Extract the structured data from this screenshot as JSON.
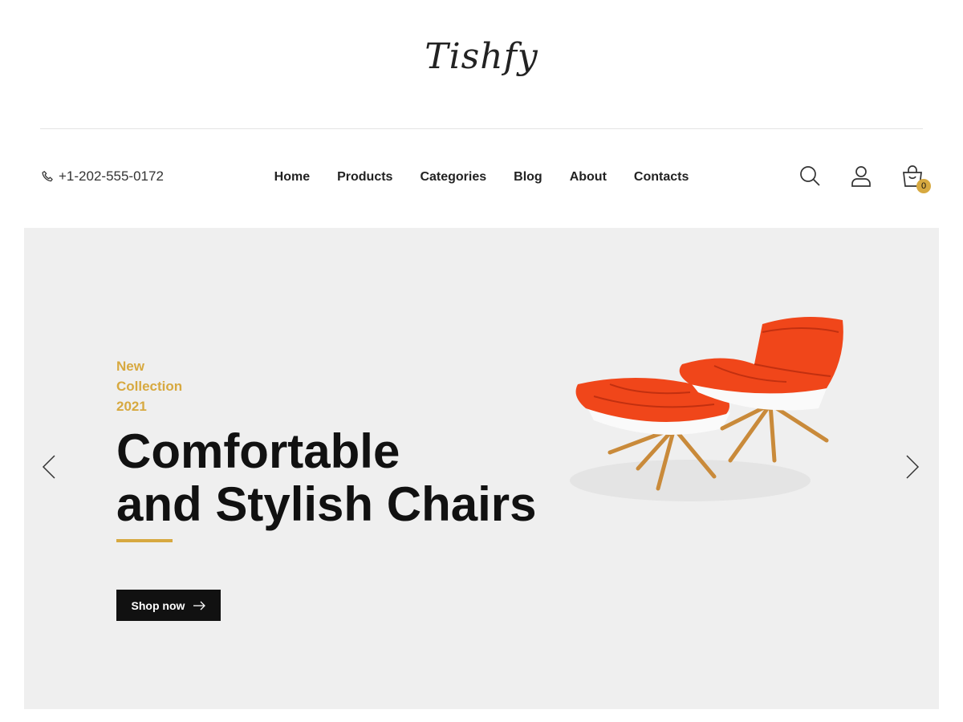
{
  "brand": {
    "logo_text": "Tishfy"
  },
  "header": {
    "phone": "+1-202-555-0172",
    "nav": [
      "Home",
      "Products",
      "Categories",
      "Blog",
      "About",
      "Contacts"
    ],
    "cart_count": "0"
  },
  "hero": {
    "eyebrow_line1": "New",
    "eyebrow_line2": "Collection",
    "eyebrow_line3": "2021",
    "headline_line1": "Comfortable",
    "headline_line2": "and Stylish Chairs",
    "button_label": "Shop now"
  },
  "colors": {
    "accent": "#d7a940",
    "hero_bg": "#efefef",
    "text": "#111111",
    "chair": "#f0461a",
    "chair_legs": "#c98a3a"
  },
  "icons": [
    "phone-icon",
    "search-icon",
    "user-icon",
    "shopping-bag-icon",
    "chevron-left-icon",
    "chevron-right-icon",
    "arrow-right-icon"
  ]
}
